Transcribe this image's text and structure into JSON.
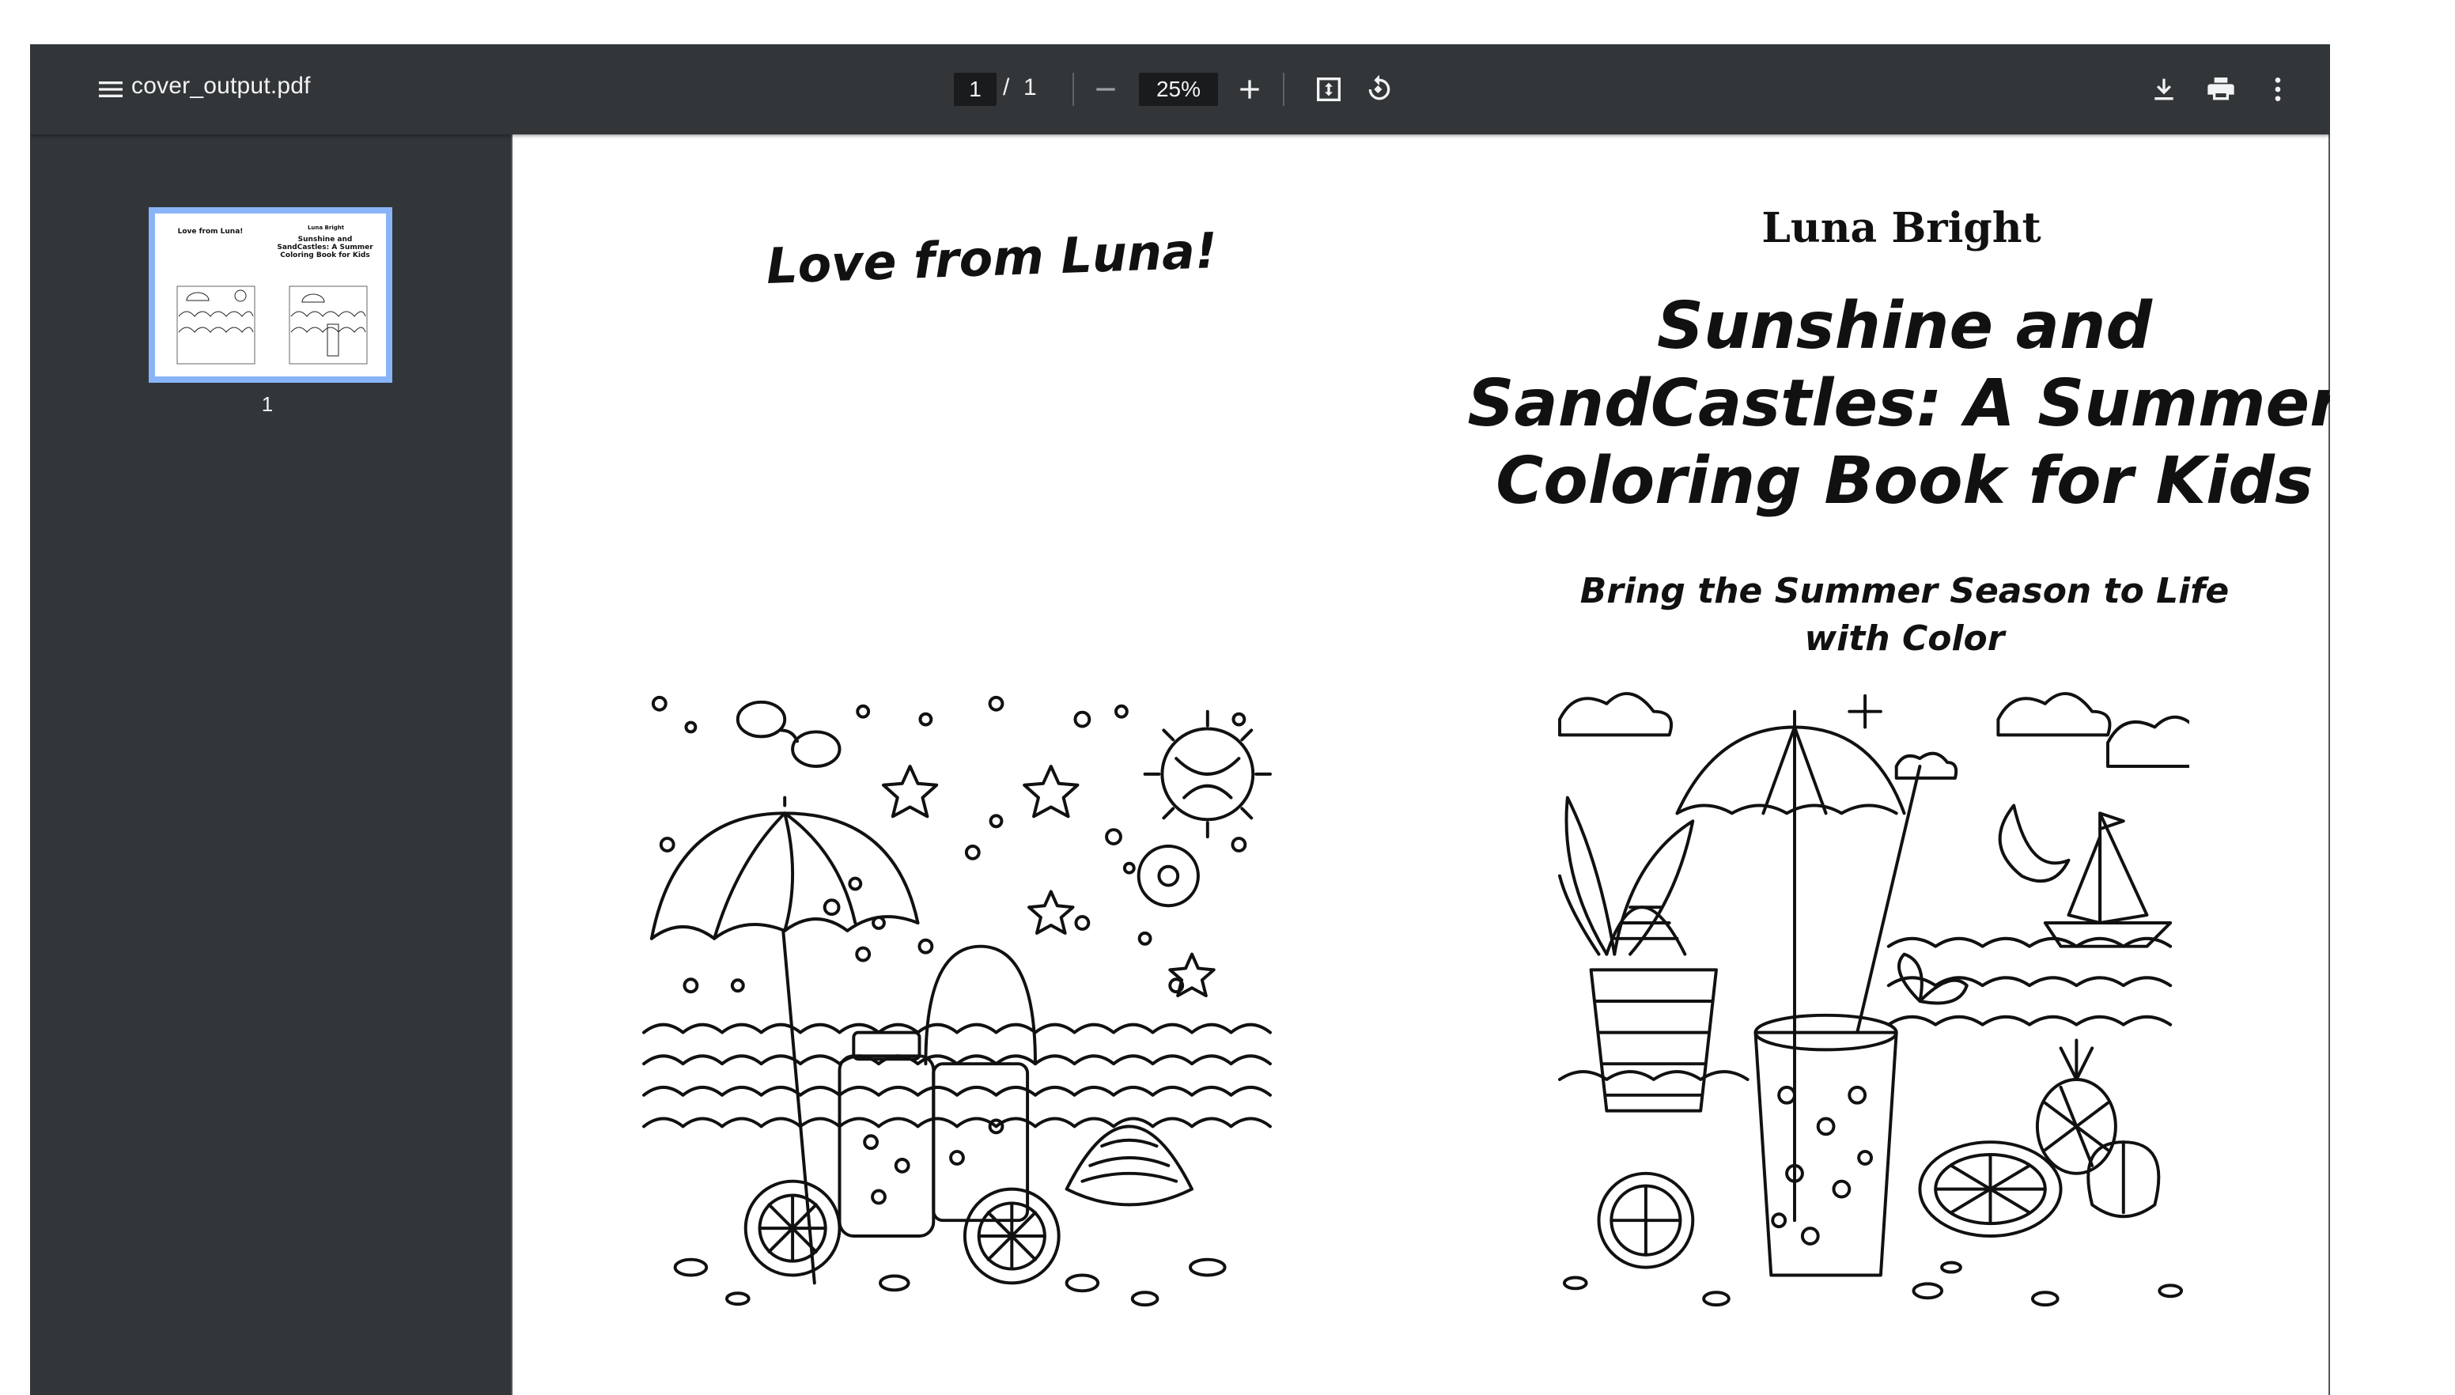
{
  "toolbar": {
    "filename": "cover_output.pdf",
    "page_current": "1",
    "page_separator": "/",
    "page_total": "1",
    "zoom": "25%",
    "icons": [
      "menu-icon",
      "zoom-out-icon",
      "zoom-in-icon",
      "fit-page-icon",
      "rotate-icon",
      "download-icon",
      "print-icon",
      "more-vert-icon"
    ]
  },
  "sidebar": {
    "thumbnail_label": "1"
  },
  "document": {
    "back_cover_text": "Love from Luna!",
    "author": "Luna Bright",
    "title": "Sunshine and SandCastles: A Summer Coloring Book for Kids",
    "subtitle": "Bring the Summer Season to Life with Color"
  },
  "colors": {
    "toolbar_bg": "#323639",
    "viewer_bg": "#525659",
    "thumb_highlight": "#8ab4f8",
    "text_light": "#f1f3f4"
  }
}
